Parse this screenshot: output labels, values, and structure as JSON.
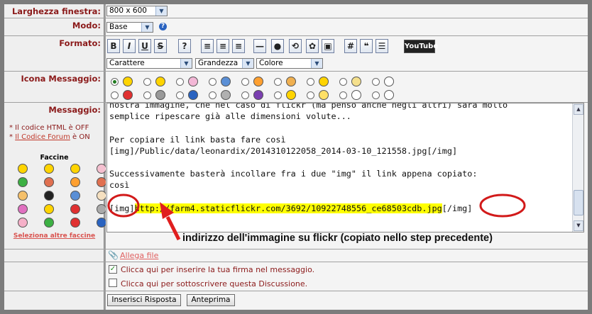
{
  "labels": {
    "larghezza": "Larghezza finestra:",
    "modo": "Modo:",
    "formato": "Formato:",
    "icona": "Icona Messaggio:",
    "messaggio": "Messaggio:"
  },
  "selects": {
    "larghezza": "800 x 600",
    "modo": "Base",
    "carattere": "Carattere",
    "grandezza": "Grandezza",
    "colore": "Colore"
  },
  "toolbar": [
    "B",
    "I",
    "U",
    "S",
    "?",
    "≡",
    "≡",
    "≡",
    "—",
    "●",
    "⟲",
    "✿",
    "▣",
    "#",
    "❝",
    "☰"
  ],
  "youtube": "YouTube",
  "sidebar": {
    "html_off": "* Il codice HTML è OFF",
    "forum_on_prefix": "* ",
    "forum_link": "Il Codice Forum",
    "forum_on_suffix": " è ON",
    "faccine_title": "Faccine",
    "more_smilies": "Seleziona altre faccine"
  },
  "message_lines": {
    "l0": "nostra immagine, che nel caso di flickr (ma penso anche negli altri) sarà molto",
    "l1": "semplice ripescare già alle dimensioni volute...",
    "l2": "",
    "l3": "Per copiare il link basta fare così",
    "l4": "[img]/Public/data/leonardix/2014310122058_2014-03-10_121558.jpg[/img]",
    "l5": "",
    "l6": "Successivamente basterà incollare fra i due \"img\" il link appena copiato:",
    "l7": "così",
    "l8": "",
    "l9a": "[img]",
    "l9b": "http://farm4.staticflickr.com/3692/10922748556_ce68503cdb.jpg",
    "l9c": "[/img]"
  },
  "annotation": "indirizzo dell'immagine su flickr (copiato nello step precedente)",
  "attach": "Allega file",
  "options": {
    "firma": "Clicca qui per inserire la tua firma nel messaggio.",
    "firma_checked": true,
    "sottoscrivi": "Clicca qui per sottoscrivere questa Discussione.",
    "sottoscrivi_checked": false
  },
  "buttons": {
    "submit": "Inserisci Risposta",
    "preview": "Anteprima"
  },
  "colors": {
    "label_red": "#8b1a1a",
    "highlight": "#ffff00",
    "circle_red": "#d21a1a"
  }
}
